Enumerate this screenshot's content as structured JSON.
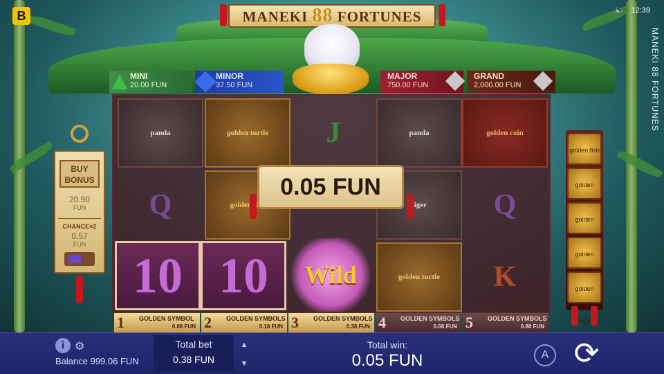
{
  "title": {
    "pre": "MANEKI ",
    "num": "88",
    "post": " FORTUNES"
  },
  "side_title": "MANEKI 88 FORTUNES",
  "status": {
    "time": "12:39",
    "sound_icon": "speaker-icon"
  },
  "brand": "B",
  "jackpots": [
    {
      "name": "MINI",
      "value": "20.00 FUN",
      "color": "#3fbf4a"
    },
    {
      "name": "MINOR",
      "value": "37.50 FUN",
      "color": "#3a6ae8"
    },
    {
      "name": "MAJOR",
      "value": "750.00 FUN",
      "color": "#c8c8c8"
    },
    {
      "name": "GRAND",
      "value": "2,000.00 FUN",
      "color": "#c8c8c8"
    }
  ],
  "win_popup": "0.05 FUN",
  "reels": {
    "row1": [
      "panda",
      "golden turtle",
      "J",
      "panda",
      "golden coin"
    ],
    "row2": [
      "Q",
      "golden fish",
      "",
      "tiger",
      "Q"
    ],
    "row3": [
      "10",
      "10",
      "Wild",
      "golden turtle",
      "K"
    ]
  },
  "collect_bar": [
    {
      "n": "1",
      "label": "GOLDEN SYMBOL",
      "value": "0.08 FUN"
    },
    {
      "n": "2",
      "label": "GOLDEN SYMBOLS",
      "value": "0.18 FUN"
    },
    {
      "n": "3",
      "label": "GOLDEN SYMBOLS",
      "value": "0.38 FUN"
    },
    {
      "n": "4",
      "label": "GOLDEN SYMBOLS",
      "value": "0.68 FUN"
    },
    {
      "n": "5",
      "label": "GOLDEN SYMBOLS",
      "value": "0.88 FUN"
    }
  ],
  "buy_bonus": {
    "label": "BUY BONUS",
    "price": "20.90",
    "unit": "FUN",
    "chance_label": "CHANCE×2",
    "chance_value": "0.57",
    "chance_unit": "FUN"
  },
  "rail_symbols": [
    "golden fish",
    "golden turtle",
    "golden phoenix",
    "golden tiger",
    "golden dragon"
  ],
  "bottom": {
    "balance": "Balance 999.06 FUN",
    "total_bet_label": "Total bet",
    "total_bet_value": "0.38 FUN",
    "total_win_label": "Total win:",
    "total_win_value": "0.05 FUN",
    "auto_label": "A"
  }
}
